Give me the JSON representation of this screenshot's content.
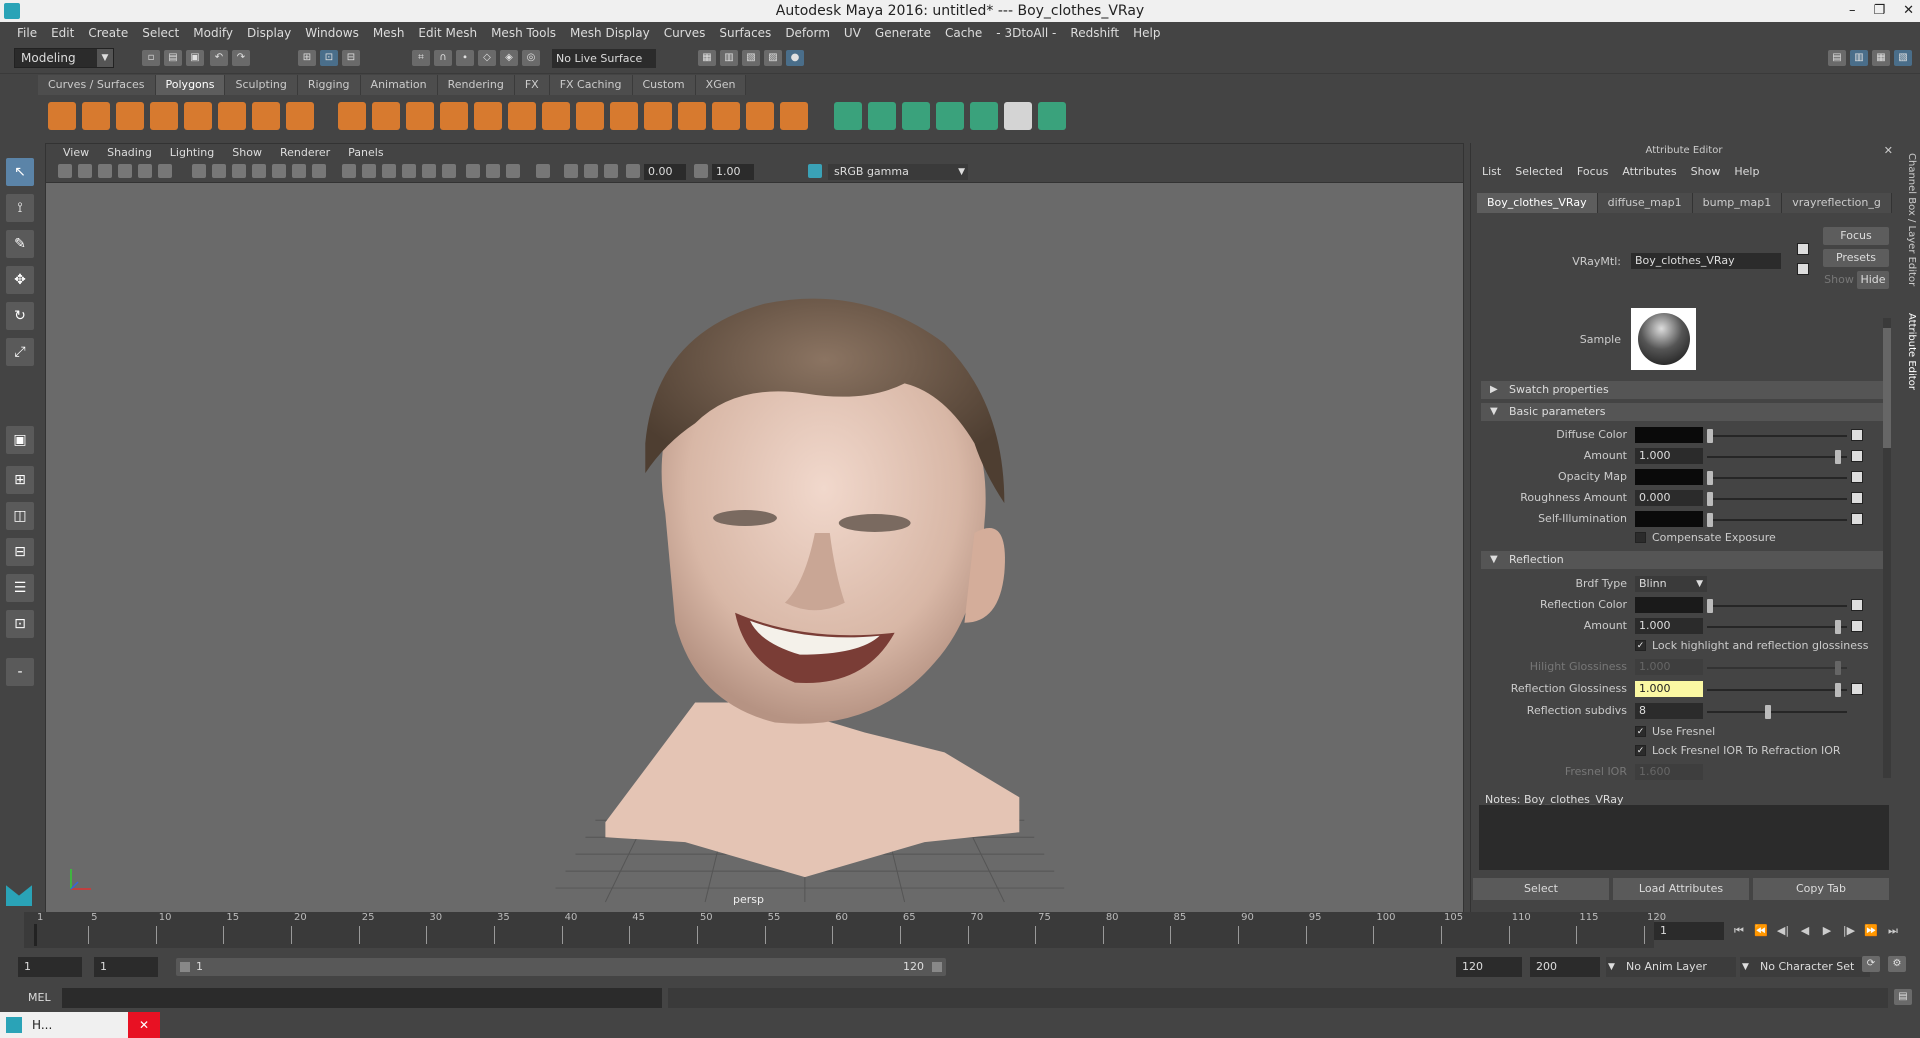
{
  "window": {
    "title": "Autodesk Maya 2016: untitled*   ---   Boy_clothes_VRay",
    "controls": [
      "–",
      "❐",
      "✕"
    ]
  },
  "menubar": [
    "File",
    "Edit",
    "Create",
    "Select",
    "Modify",
    "Display",
    "Windows",
    "Mesh",
    "Edit Mesh",
    "Mesh Tools",
    "Mesh Display",
    "Curves",
    "Surfaces",
    "Deform",
    "UV",
    "Generate",
    "Cache",
    "- 3DtoAll -",
    "Redshift",
    "Help"
  ],
  "statusline": {
    "mode": "Modeling",
    "live_surface": "No Live Surface"
  },
  "shelf": {
    "tabs": [
      "Curves / Surfaces",
      "Polygons",
      "Sculpting",
      "Rigging",
      "Animation",
      "Rendering",
      "FX",
      "FX Caching",
      "Custom",
      "XGen"
    ],
    "active_tab": "Polygons"
  },
  "viewport": {
    "menu": [
      "View",
      "Shading",
      "Lighting",
      "Show",
      "Renderer",
      "Panels"
    ],
    "exposure": "0.00",
    "gamma_value": "1.00",
    "color_space": "sRGB gamma",
    "camera_label": "persp"
  },
  "attribute_editor": {
    "title": "Attribute Editor",
    "menu": [
      "List",
      "Selected",
      "Focus",
      "Attributes",
      "Show",
      "Help"
    ],
    "tabs": [
      "Boy_clothes_VRay",
      "diffuse_map1",
      "bump_map1",
      "vrayreflection_g"
    ],
    "buttons": {
      "focus": "Focus",
      "presets": "Presets",
      "show": "Show",
      "hide": "Hide"
    },
    "material_label": "VRayMtl:",
    "material_name": "Boy_clothes_VRay",
    "sample_label": "Sample",
    "sections": {
      "swatch": "Swatch properties",
      "basic": "Basic parameters",
      "reflection": "Reflection"
    },
    "basic": {
      "diffuse_color": "Diffuse Color",
      "amount": "Amount",
      "amount_value": "1.000",
      "opacity_map": "Opacity Map",
      "roughness_amount": "Roughness Amount",
      "roughness_value": "0.000",
      "self_illumination": "Self-Illumination",
      "compensate_exposure": "Compensate Exposure"
    },
    "reflection": {
      "brdf_type": "Brdf Type",
      "brdf_value": "Blinn",
      "reflection_color": "Reflection Color",
      "amount": "Amount",
      "amount_value": "1.000",
      "lock_highlight": "Lock highlight and reflection glossiness",
      "hilight_glossiness": "Hilight Glossiness",
      "hilight_value": "1.000",
      "reflection_glossiness": "Reflection Glossiness",
      "reflection_glossiness_value": "1.000",
      "reflection_subdivs": "Reflection subdivs",
      "subdivs_value": "8",
      "use_fresnel": "Use Fresnel",
      "lock_fresnel": "Lock Fresnel IOR To Refraction IOR",
      "fresnel_ior": "Fresnel IOR",
      "fresnel_value": "1.600"
    },
    "notes": "Notes:  Boy_clothes_VRay",
    "bottom_buttons": [
      "Select",
      "Load Attributes",
      "Copy Tab"
    ]
  },
  "side_tabs": [
    "Channel Box / Layer Editor",
    "Attribute Editor"
  ],
  "timeline": {
    "ticks": [
      "1",
      "5",
      "10",
      "15",
      "20",
      "25",
      "30",
      "35",
      "40",
      "45",
      "50",
      "55",
      "60",
      "65",
      "70",
      "75",
      "80",
      "85",
      "90",
      "95",
      "100",
      "105",
      "110",
      "115",
      "120"
    ],
    "current_frame": "1"
  },
  "range": {
    "start": "1",
    "playback_start": "1",
    "slider_start": "1",
    "slider_end": "120",
    "playback_end": "120",
    "end": "200",
    "anim_layer": "No Anim Layer",
    "character_set": "No Character Set"
  },
  "cmdline": {
    "label": "MEL"
  },
  "taskbar": {
    "label": "H..."
  },
  "colors": {
    "accent": "#5b84a8",
    "shelf_orange": "#d77a2f",
    "shelf_green": "#3aa27c",
    "highlight_field": "#fbf8a3"
  }
}
